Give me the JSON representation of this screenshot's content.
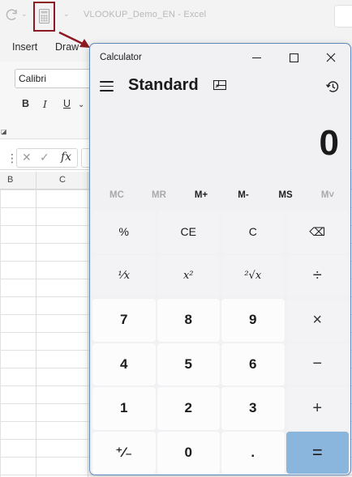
{
  "excel": {
    "title": "VLOOKUP_Demo_EN  -  Excel",
    "tabs": [
      "Insert",
      "Draw"
    ],
    "font_name": "Calibri",
    "format_buttons": [
      "B",
      "I",
      "U"
    ],
    "column_headers": [
      "B",
      "C"
    ]
  },
  "calculator": {
    "window_title": "Calculator",
    "mode": "Standard",
    "display": "0",
    "memory": [
      {
        "label": "MC",
        "enabled": false
      },
      {
        "label": "MR",
        "enabled": false
      },
      {
        "label": "M+",
        "enabled": true
      },
      {
        "label": "M-",
        "enabled": true
      },
      {
        "label": "MS",
        "enabled": true
      },
      {
        "label": "M˅",
        "enabled": false
      }
    ],
    "keys": [
      {
        "label": "%",
        "kind": "fn",
        "name": "percent-button"
      },
      {
        "label": "CE",
        "kind": "fn",
        "name": "clear-entry-button"
      },
      {
        "label": "C",
        "kind": "fn",
        "name": "clear-button"
      },
      {
        "label": "⌫",
        "kind": "fn",
        "name": "backspace-button"
      },
      {
        "label": "¹⁄x",
        "kind": "fn-serif",
        "name": "reciprocal-button"
      },
      {
        "label": "x²",
        "kind": "fn-serif",
        "name": "square-button"
      },
      {
        "label": "²√x",
        "kind": "fn-serif",
        "name": "square-root-button"
      },
      {
        "label": "÷",
        "kind": "op",
        "name": "divide-button"
      },
      {
        "label": "7",
        "kind": "num",
        "name": "digit-7-button"
      },
      {
        "label": "8",
        "kind": "num",
        "name": "digit-8-button"
      },
      {
        "label": "9",
        "kind": "num",
        "name": "digit-9-button"
      },
      {
        "label": "×",
        "kind": "op",
        "name": "multiply-button"
      },
      {
        "label": "4",
        "kind": "num",
        "name": "digit-4-button"
      },
      {
        "label": "5",
        "kind": "num",
        "name": "digit-5-button"
      },
      {
        "label": "6",
        "kind": "num",
        "name": "digit-6-button"
      },
      {
        "label": "−",
        "kind": "op",
        "name": "subtract-button"
      },
      {
        "label": "1",
        "kind": "num",
        "name": "digit-1-button"
      },
      {
        "label": "2",
        "kind": "num",
        "name": "digit-2-button"
      },
      {
        "label": "3",
        "kind": "num",
        "name": "digit-3-button"
      },
      {
        "label": "+",
        "kind": "op",
        "name": "add-button"
      },
      {
        "label": "⁺⁄₋",
        "kind": "num",
        "name": "negate-button"
      },
      {
        "label": "0",
        "kind": "num",
        "name": "digit-0-button"
      },
      {
        "label": ".",
        "kind": "num",
        "name": "decimal-button"
      },
      {
        "label": "=",
        "kind": "eq",
        "name": "equals-button"
      }
    ],
    "colors": {
      "accent": "#8ab5dc",
      "border": "#5f89b9",
      "annotation": "#8b1a22"
    }
  }
}
